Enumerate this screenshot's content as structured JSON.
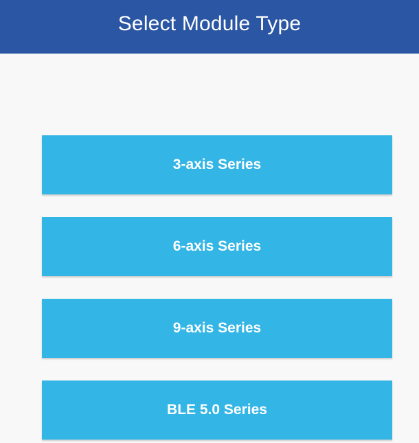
{
  "header": {
    "title": "Select Module Type"
  },
  "modules": [
    {
      "label": "3-axis Series"
    },
    {
      "label": "6-axis Series"
    },
    {
      "label": "9-axis Series"
    },
    {
      "label": "BLE 5.0 Series"
    }
  ],
  "colors": {
    "header_bg": "#2b56a3",
    "button_bg": "#33b5e5",
    "page_bg": "#f8f8f8",
    "text": "#ffffff"
  }
}
